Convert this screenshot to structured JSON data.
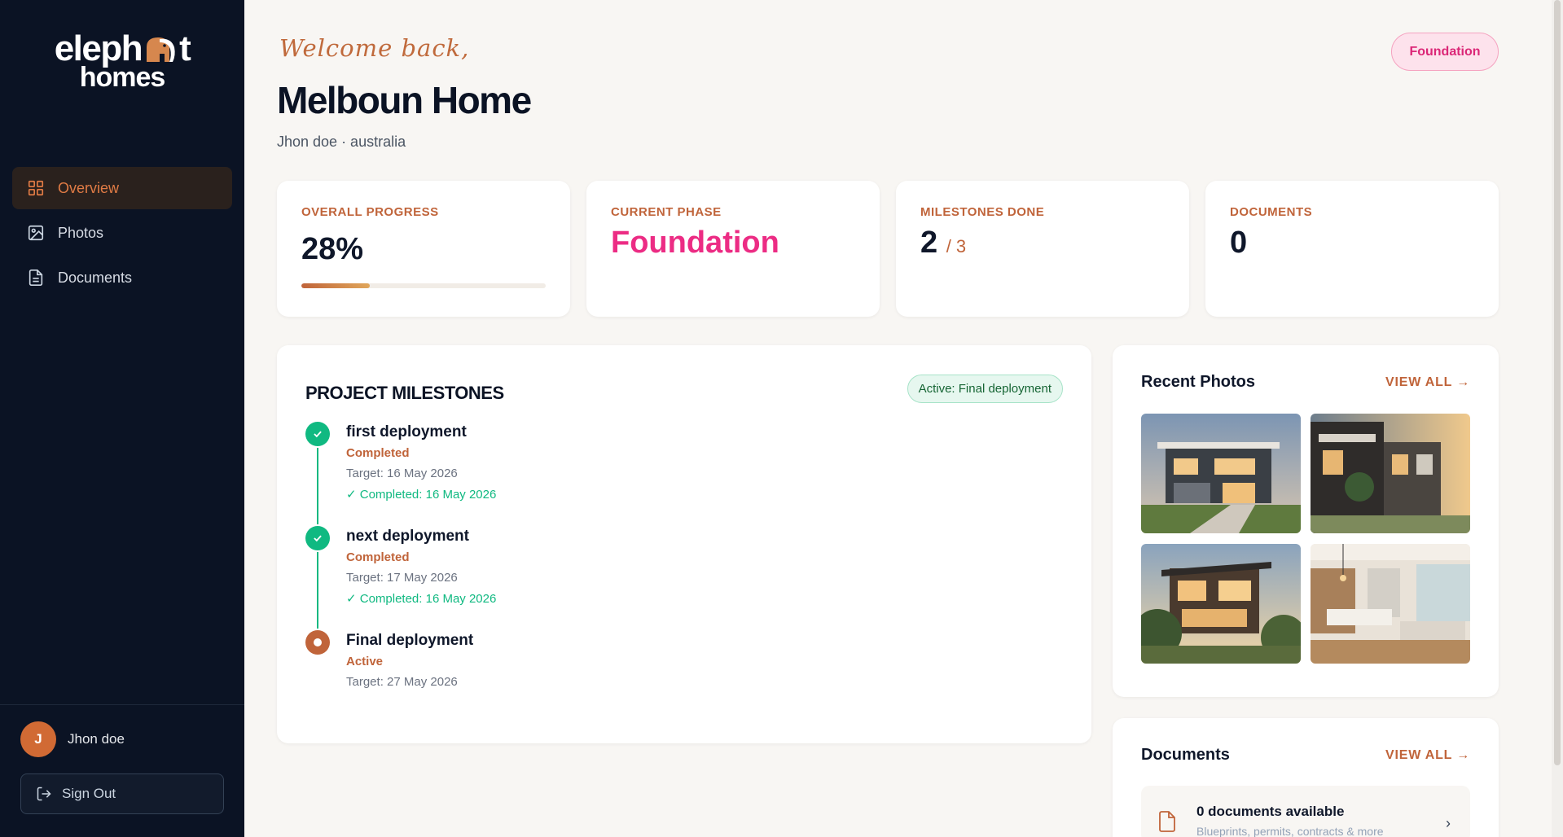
{
  "brand": {
    "line1_a": "eleph",
    "line1_b": "t",
    "line2": "homes"
  },
  "sidebar": {
    "items": [
      {
        "label": "Overview",
        "icon": "grid-icon",
        "active": true
      },
      {
        "label": "Photos",
        "icon": "image-icon",
        "active": false
      },
      {
        "label": "Documents",
        "icon": "document-icon",
        "active": false
      }
    ],
    "user": {
      "initial": "J",
      "name": "Jhon doe"
    },
    "signout_label": "Sign Out"
  },
  "header": {
    "welcome": "Welcome back,",
    "title": "Melboun Home",
    "subtitle": "Jhon doe · australia",
    "phase_badge": "Foundation"
  },
  "stats": {
    "progress": {
      "label": "OVERALL PROGRESS",
      "value": "28%",
      "fraction": 0.28
    },
    "phase": {
      "label": "CURRENT PHASE",
      "value": "Foundation"
    },
    "milestones": {
      "label": "MILESTONES DONE",
      "done": "2",
      "total": "/ 3"
    },
    "documents": {
      "label": "DOCUMENTS",
      "value": "0"
    }
  },
  "milestones": {
    "title": "PROJECT MILESTONES",
    "active_pill": "Active: Final deployment",
    "items": [
      {
        "name": "first deployment",
        "status": "Completed",
        "target": "Target: 16 May 2026",
        "completed": "✓ Completed: 16 May 2026"
      },
      {
        "name": "next deployment",
        "status": "Completed",
        "target": "Target: 17 May 2026",
        "completed": "✓ Completed: 16 May 2026"
      },
      {
        "name": "Final deployment",
        "status": "Active",
        "target": "Target: 27 May 2026"
      }
    ]
  },
  "photos": {
    "title": "Recent Photos",
    "view_all": "VIEW ALL →"
  },
  "documents_panel": {
    "title": "Documents",
    "view_all": "VIEW ALL →",
    "row_title": "0 documents available",
    "row_sub": "Blueprints, permits, contracts & more"
  },
  "colors": {
    "accent": "#c0643a",
    "pink": "#ec2c84",
    "success": "#10b981",
    "sidebar_bg": "#0b1324"
  }
}
